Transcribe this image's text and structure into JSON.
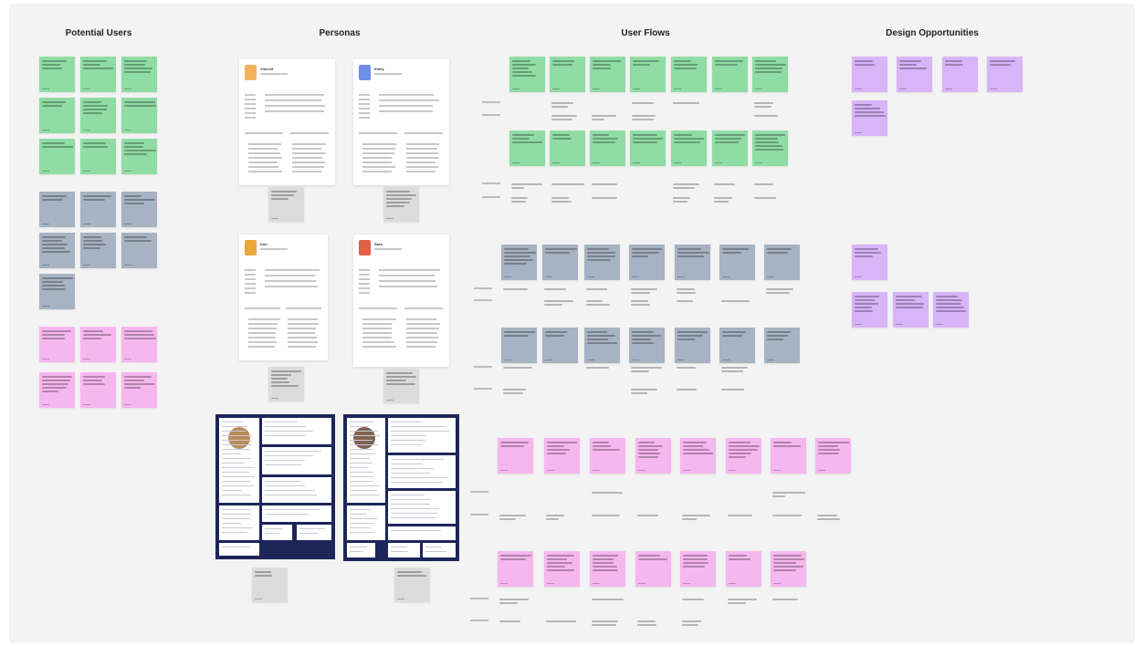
{
  "board": {
    "sections": {
      "potential_users": "Potential Users",
      "personas": "Personas",
      "user_flows": "User Flows",
      "design_opportunities": "Design Opportunities"
    },
    "persona_cards": [
      {
        "name": "Vincent",
        "avatar": "person-avatar-icon"
      },
      {
        "name": "Emily",
        "avatar": "person-avatar-icon"
      },
      {
        "name": "Karl",
        "avatar": "person-avatar-icon"
      },
      {
        "name": "Sara",
        "avatar": "person-avatar-icon"
      }
    ],
    "colors": {
      "board_bg": "#f3f3f3",
      "green_sticky": "#8fdca4",
      "blue_sticky": "#a7b2c3",
      "pink_sticky": "#f6b7ef",
      "purple_sticky": "#d8b4f8",
      "gray_sticky": "#dcdcdc",
      "navy_card": "#1d2559"
    }
  }
}
